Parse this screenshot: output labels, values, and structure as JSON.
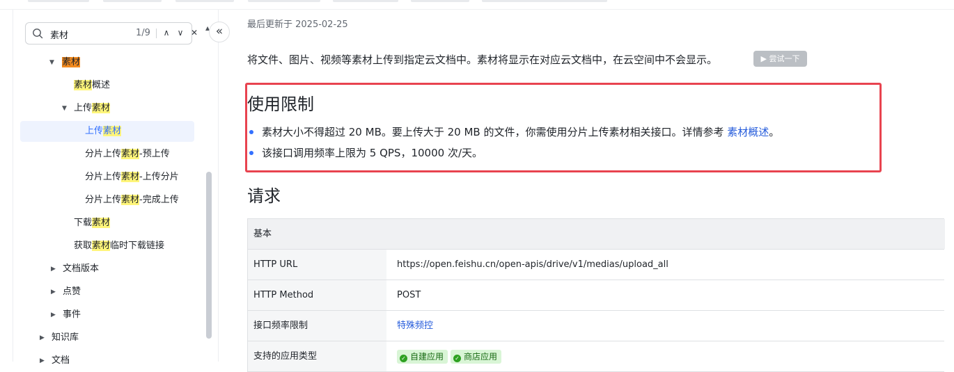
{
  "search": {
    "value": "素材",
    "count": "1/9",
    "prev": "∧",
    "next": "∨",
    "close": "✕"
  },
  "tree": {
    "node_material": "素材",
    "overview_hl": "素材",
    "overview_rest": "概述",
    "upload_group_pre": "上传",
    "upload_group_hl": "素材",
    "upload_pre": "上传",
    "upload_hl": "素材",
    "chunk_pre_1": "分片上传",
    "chunk_hl_1": "素材",
    "chunk_post_1": "-预上传",
    "chunk_pre_2": "分片上传",
    "chunk_hl_2": "素材",
    "chunk_post_2": "-上传分片",
    "chunk_pre_3": "分片上传",
    "chunk_hl_3": "素材",
    "chunk_post_3": "-完成上传",
    "download_pre": "下载",
    "download_hl": "素材",
    "link_pre": "获取",
    "link_hl": "素材",
    "link_post": "临时下载链接",
    "versions": "文档版本",
    "likes": "点赞",
    "events": "事件",
    "wiki": "知识库",
    "docs": "文档"
  },
  "main": {
    "updated": "最后更新于 2025-02-25",
    "intro": "将文件、图片、视频等素材上传到指定云文档中。素材将显示在对应云文档中，在云空间中不会显示。",
    "try": "▶ 尝试一下",
    "limits_title": "使用限制",
    "limit1_text": "素材大小不得超过 20 MB。要上传大于 20 MB 的文件，你需使用分片上传素材相关接口。详情参考 ",
    "limit1_link": "素材概述",
    "limit1_end": "。",
    "limit2_text": "该接口调用频率上限为 5 QPS，10000 次/天。",
    "request_title": "请求"
  },
  "table": {
    "header": "基本",
    "rows": [
      {
        "key": "HTTP URL",
        "value": "https://open.feishu.cn/open-apis/drive/v1/medias/upload_all"
      },
      {
        "key": "HTTP Method",
        "value": "POST"
      },
      {
        "key": "接口频率限制",
        "value": "特殊频控"
      },
      {
        "key": "支持的应用类型",
        "tag1": "自建应用",
        "tag2": "商店应用"
      }
    ]
  },
  "colors": {
    "accent": "#3370ff",
    "highlight": "#fff57a",
    "active_highlight": "#f28a1f",
    "box": "#e8434f",
    "tag_bg": "#d9f5d6"
  }
}
